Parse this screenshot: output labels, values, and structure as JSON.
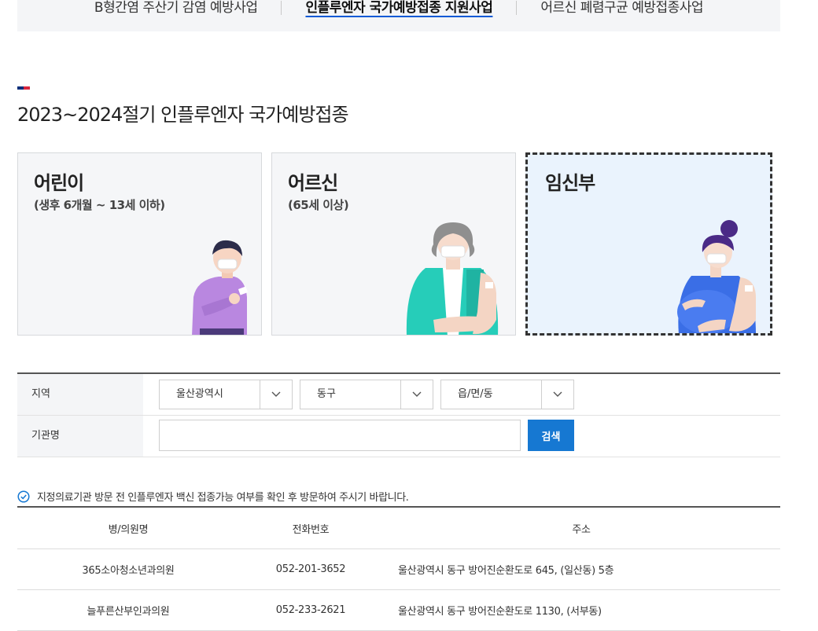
{
  "nav": {
    "tabs": [
      {
        "label": "B형간염 주산기 감염 예방사업",
        "active": false
      },
      {
        "label": "인플루엔자 국가예방접종 지원사업",
        "active": true
      },
      {
        "label": "어르신 폐렴구균 예방접종사업",
        "active": false
      }
    ]
  },
  "page": {
    "title": "2023~2024절기 인플루엔자 국가예방접종"
  },
  "colors": {
    "accent_blue": "#0a5ad6",
    "accent_red": "#d8263d",
    "search_button": "#1678d2"
  },
  "cards": [
    {
      "title": "어린이",
      "subtitle": "(생후 6개월 ~ 13세 이하)",
      "selected": false,
      "icon": "child-illustration"
    },
    {
      "title": "어르신",
      "subtitle": "(65세 이상)",
      "selected": false,
      "icon": "elderly-illustration"
    },
    {
      "title": "임신부",
      "subtitle": "",
      "selected": true,
      "icon": "pregnant-woman-illustration"
    }
  ],
  "form": {
    "region_label": "지역",
    "institution_label": "기관명",
    "selects": [
      {
        "value": "울산광역시"
      },
      {
        "value": "동구"
      },
      {
        "value": "읍/면/동"
      }
    ],
    "institution_input": {
      "value": "",
      "placeholder": ""
    },
    "search_label": "검색"
  },
  "notice": {
    "icon": "check-circle-icon",
    "text": "지정의료기관 방문 전 인플루엔자 백신 접종가능 여부를 확인 후 방문하여 주시기 바랍니다."
  },
  "table": {
    "headers": [
      "병/의원명",
      "전화번호",
      "주소"
    ],
    "rows": [
      [
        "365소아청소년과의원",
        "052-201-3652",
        "울산광역시 동구 방어진순환도로 645, (일산동) 5층"
      ],
      [
        "늘푸른산부인과의원",
        "052-233-2621",
        "울산광역시 동구 방어진순환도로 1130, (서부동)"
      ]
    ]
  }
}
